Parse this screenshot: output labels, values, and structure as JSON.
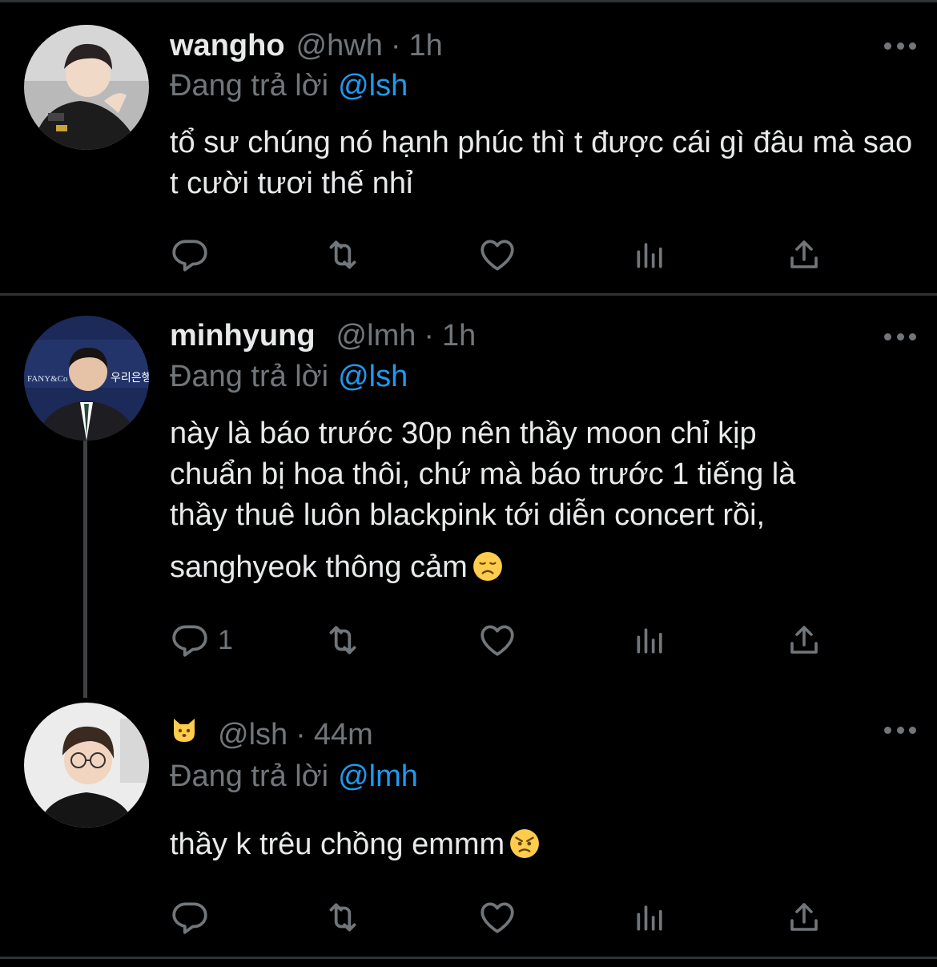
{
  "tweets": [
    {
      "name": "wangho",
      "handle": "@hwh",
      "separator": "·",
      "time": "1h",
      "reply_label": "Đang trả lời",
      "reply_to": "@lsh",
      "text": "tổ sư chúng nó hạnh phúc thì t được cái gì đâu mà sao t cười tươi thế nhỉ",
      "reply_count": "",
      "icons": [
        "reply-icon",
        "retweet-icon",
        "like-icon",
        "views-icon",
        "share-icon"
      ]
    },
    {
      "name": "minhyung",
      "handle": "@lmh",
      "separator": "·",
      "time": "1h",
      "reply_label": "Đang trả lời",
      "reply_to": "@lsh",
      "text_lines": [
        "này là báo trước 30p nên thầy moon chỉ kịp",
        "chuẩn bị hoa thôi, chứ mà báo trước 1 tiếng là",
        "thầy thuê luôn blackpink tới diễn concert rồi,",
        "sanghyeok thông cảm"
      ],
      "text_emoji": "disappointed-face-emoji",
      "reply_count": "1"
    },
    {
      "name_emoji": "cat-face-emoji",
      "handle": "@lsh",
      "separator": "·",
      "time": "44m",
      "reply_label": "Đang trả lời",
      "reply_to": "@lmh",
      "text": "thầy k trêu chồng emmm",
      "text_emoji": "angry-face-emoji",
      "reply_count": ""
    }
  ],
  "colors": {
    "background": "#000000",
    "text": "#e7e9ea",
    "secondary": "#71767b",
    "link": "#1d9bf0",
    "divider": "#2f3336"
  }
}
